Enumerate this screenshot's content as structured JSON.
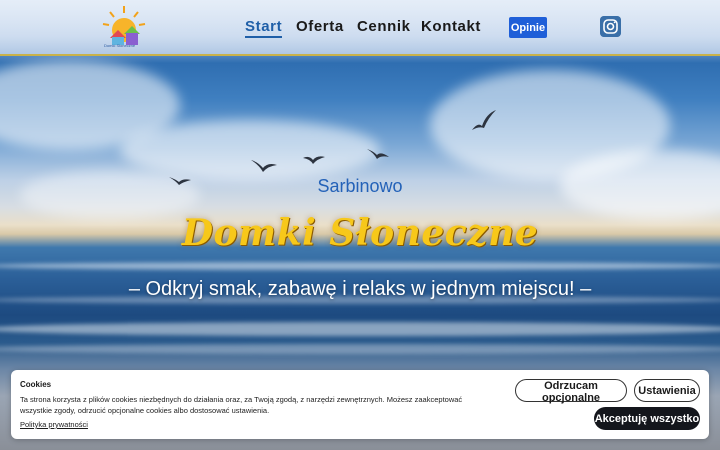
{
  "header": {
    "logo_text": "Domki Słoneczne",
    "nav": [
      {
        "label": "Start",
        "active": true
      },
      {
        "label": "Oferta",
        "active": false
      },
      {
        "label": "Cennik",
        "active": false
      },
      {
        "label": "Kontakt",
        "active": false
      }
    ],
    "opinie_label": "Opinie",
    "social_icon": "instagram-icon"
  },
  "hero": {
    "subtitle": "Sarbinowo",
    "title": "Domki Słoneczne",
    "tagline": "– Odkryj smak, zabawę i relaks w jednym miejscu! –",
    "title_color": "#f7c81a"
  },
  "cookie": {
    "title": "Cookies",
    "text": "Ta strona korzysta z plików cookies niezbędnych do działania oraz, za Twoją zgodą, z narzędzi zewnętrznych. Możesz zaakceptować wszystkie zgody, odrzucić opcjonalne cookies albo dostosować ustawienia.",
    "policy_link": "Polityka prywatności",
    "reject_label": "Odrzucam opcjonalne",
    "settings_label": "Ustawienia",
    "accept_label": "Akceptuję wszystko"
  },
  "colors": {
    "accent": "#1f5fa8",
    "opinie_bg": "#1f5fd8",
    "accept_bg": "#14161c"
  }
}
